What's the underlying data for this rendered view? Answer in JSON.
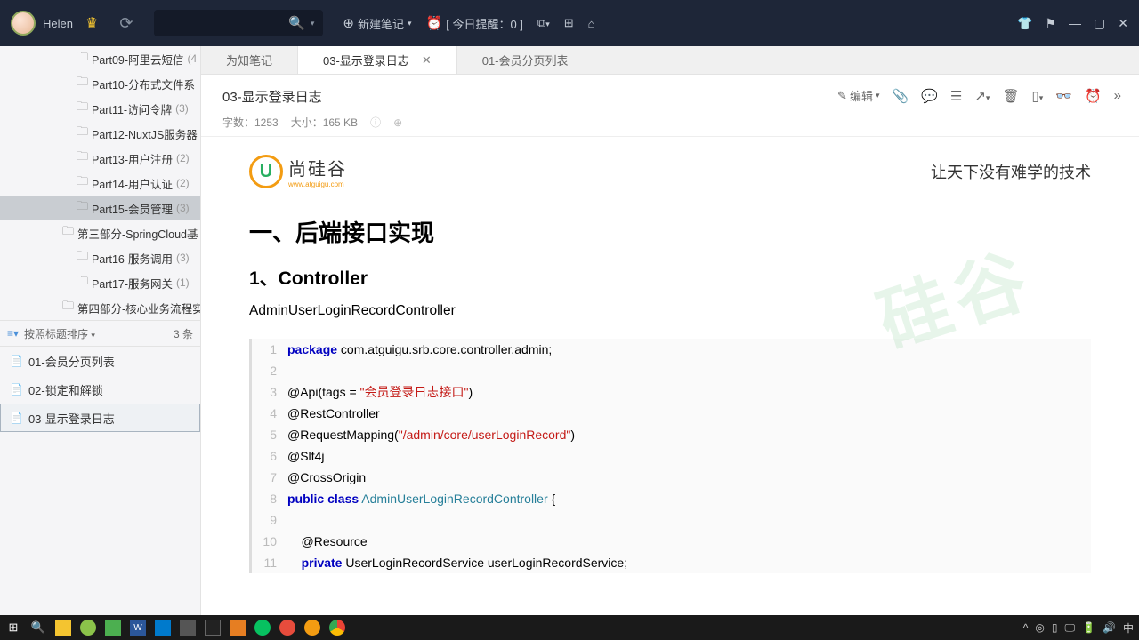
{
  "titlebar": {
    "username": "Helen"
  },
  "topbtns": {
    "newnote": "新建笔记",
    "reminder": "[ 今日提醒：0 ]"
  },
  "tree": [
    {
      "label": "Part09-阿里云短信",
      "count": "(4",
      "lv": 3
    },
    {
      "label": "Part10-分布式文件系",
      "count": "",
      "lv": 3
    },
    {
      "label": "Part11-访问令牌",
      "count": "(3)",
      "lv": 3
    },
    {
      "label": "Part12-NuxtJS服务器",
      "count": "",
      "lv": 3
    },
    {
      "label": "Part13-用户注册",
      "count": "(2)",
      "lv": 3
    },
    {
      "label": "Part14-用户认证",
      "count": "(2)",
      "lv": 3
    },
    {
      "label": "Part15-会员管理",
      "count": "(3)",
      "lv": 3,
      "sel": true
    },
    {
      "label": "第三部分-SpringCloud基",
      "count": "",
      "lv": 2
    },
    {
      "label": "Part16-服务调用",
      "count": "(3)",
      "lv": 3
    },
    {
      "label": "Part17-服务网关",
      "count": "(1)",
      "lv": 3
    },
    {
      "label": "第四部分-核心业务流程实",
      "count": "",
      "lv": 2
    }
  ],
  "sortbar": {
    "label": "按照标题排序",
    "count": "3 条"
  },
  "notes": [
    {
      "label": "01-会员分页列表"
    },
    {
      "label": "02-锁定和解锁"
    },
    {
      "label": "03-显示登录日志",
      "sel": true
    }
  ],
  "tabs": [
    {
      "label": "为知笔记"
    },
    {
      "label": "03-显示登录日志",
      "active": true,
      "closable": true
    },
    {
      "label": "01-会员分页列表"
    }
  ],
  "chead": {
    "title": "03-显示登录日志",
    "meta1": "字数：1253",
    "meta2": "大小：165 KB",
    "edit": "编辑"
  },
  "article": {
    "logo_zh": "尚硅谷",
    "logo_en": "www.atguigu.com",
    "slogan": "让天下没有难学的技术",
    "h1": "一、后端接口实现",
    "h2": "1、Controller",
    "p": "AdminUserLoginRecordController",
    "watermark": "硅谷"
  },
  "code": [
    {
      "n": "1",
      "tokens": [
        [
          "kw",
          "package"
        ],
        [
          "",
          " com.atguigu.srb.core.controller.admin;"
        ]
      ]
    },
    {
      "n": "2",
      "tokens": []
    },
    {
      "n": "3",
      "tokens": [
        [
          "",
          "@Api(tags = "
        ],
        [
          "str",
          "\"会员登录日志接口\""
        ],
        [
          "",
          ")"
        ]
      ]
    },
    {
      "n": "4",
      "tokens": [
        [
          "",
          "@RestController"
        ]
      ]
    },
    {
      "n": "5",
      "tokens": [
        [
          "",
          "@RequestMapping("
        ],
        [
          "str",
          "\"/admin/core/userLoginRecord\""
        ],
        [
          "",
          ")"
        ]
      ]
    },
    {
      "n": "6",
      "tokens": [
        [
          "",
          "@Slf4j"
        ]
      ]
    },
    {
      "n": "7",
      "tokens": [
        [
          "",
          "@CrossOrigin"
        ]
      ]
    },
    {
      "n": "8",
      "tokens": [
        [
          "kw",
          "public"
        ],
        [
          "",
          " "
        ],
        [
          "kw",
          "class"
        ],
        [
          "",
          " "
        ],
        [
          "cls",
          "AdminUserLoginRecordController"
        ],
        [
          "",
          " {"
        ]
      ]
    },
    {
      "n": "9",
      "tokens": []
    },
    {
      "n": "10",
      "tokens": [
        [
          "",
          "    @Resource"
        ]
      ]
    },
    {
      "n": "11",
      "tokens": [
        [
          "",
          "    "
        ],
        [
          "kw",
          "private"
        ],
        [
          "",
          " UserLoginRecordService userLoginRecordService;"
        ]
      ]
    }
  ],
  "tray": {
    "ime": "中"
  }
}
